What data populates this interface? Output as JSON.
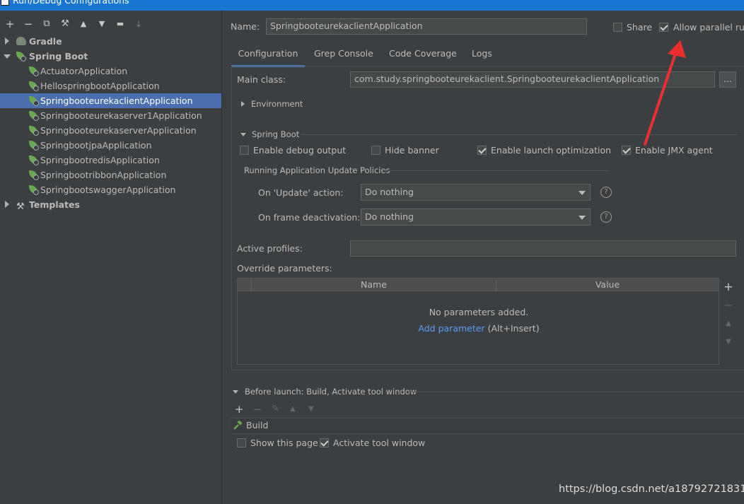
{
  "window": {
    "title": "Run/Debug Configurations"
  },
  "toolbar": {
    "add": "+",
    "remove": "−",
    "copy": "⧉",
    "wrench": "⚒",
    "up": "▲",
    "down": "▼",
    "folder": "▬",
    "sort": "↓"
  },
  "tree": {
    "gradle": "Gradle",
    "spring_boot": "Spring Boot",
    "apps": [
      "ActuatorApplication",
      "HellospringbootApplication",
      "SpringbooteurekaclientApplication",
      "Springbooteurekaserver1Application",
      "SpringbooteurekaserverApplication",
      "SpringbootjpaApplication",
      "SpringbootredisApplication",
      "SpringbootribbonApplication",
      "SpringbootswaggerApplication"
    ],
    "selected_index": 2,
    "templates": "Templates"
  },
  "header": {
    "name_label": "Name:",
    "name_value": "SpringbooteurekaclientApplication",
    "share_label": "Share",
    "share_checked": false,
    "parallel_label": "Allow parallel run",
    "parallel_checked": true
  },
  "tabs": [
    "Configuration",
    "Grep Console",
    "Code Coverage",
    "Logs"
  ],
  "config": {
    "main_class_label": "Main class:",
    "main_class_value": "com.study.springbooteurekaclient.SpringbooteurekaclientApplication",
    "browse": "...",
    "environment": "Environment",
    "spring_boot_section": "Spring Boot",
    "enable_debug": "Enable debug output",
    "hide_banner": "Hide banner",
    "launch_opt": "Enable launch optimization",
    "jmx": "Enable JMX agent",
    "policies_title": "Running Application Update Policies",
    "update_label": "On 'Update' action:",
    "update_value": "Do nothing",
    "frame_label": "On frame deactivation:",
    "frame_value": "Do nothing",
    "help": "?",
    "active_profiles": "Active profiles:",
    "override": "Override parameters:",
    "col_name": "Name",
    "col_value": "Value",
    "empty": "No parameters added.",
    "add_param": "Add parameter",
    "add_shortcut": "(Alt+Insert)",
    "side_add": "+",
    "side_remove": "−",
    "side_up": "▲",
    "side_down": "▼"
  },
  "before_launch": {
    "title": "Before launch: Build, Activate tool window",
    "add": "+",
    "remove": "−",
    "edit": "✎",
    "up": "▲",
    "down": "▼",
    "build": "Build",
    "show_page": "Show this page",
    "activate": "Activate tool window"
  },
  "watermark": "https://blog.csdn.net/a18792721831",
  "colors": {
    "accent": "#4b6eaf",
    "link": "#589df6",
    "arrow": "#e8302f",
    "bg": "#3c3f41"
  }
}
